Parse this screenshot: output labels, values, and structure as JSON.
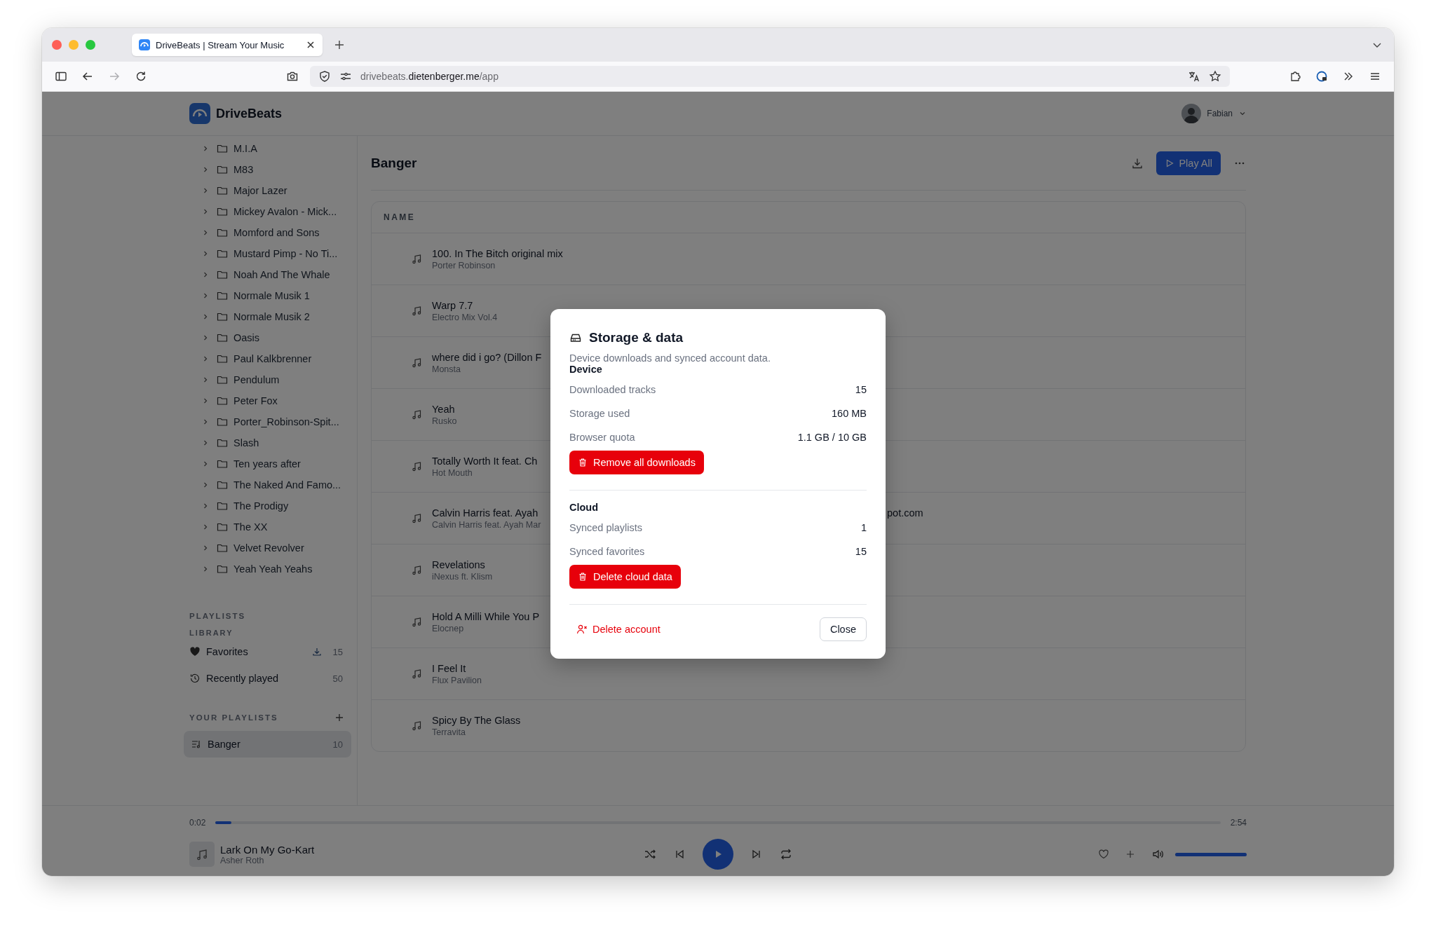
{
  "browser": {
    "tab": {
      "title": "DriveBeats | Stream Your Music"
    },
    "nav": [
      {
        "kind": "back",
        "disabled": false
      },
      {
        "kind": "forward",
        "disabled": true
      },
      {
        "kind": "reload",
        "disabled": false
      }
    ],
    "url": {
      "start": "drivebeats.",
      "domain": "dietenberger.me",
      "path": "/app"
    }
  },
  "app": {
    "name": "DriveBeats",
    "user": {
      "name": "Fabian"
    }
  },
  "sidebar": {
    "folders": [
      {
        "name": "M.I.A",
        "expanded": false
      },
      {
        "name": "M83",
        "expanded": false
      },
      {
        "name": "Major Lazer",
        "expanded": false
      },
      {
        "name": "Mickey Avalon - Mick...",
        "expanded": false
      },
      {
        "name": "Momford and Sons",
        "expanded": false
      },
      {
        "name": "Mustard Pimp - No Ti...",
        "expanded": false
      },
      {
        "name": "Noah And The Whale",
        "expanded": false
      },
      {
        "name": "Normale Musik 1",
        "expanded": false
      },
      {
        "name": "Normale Musik 2",
        "expanded": false
      },
      {
        "name": "Oasis",
        "expanded": false
      },
      {
        "name": "Paul Kalkbrenner",
        "expanded": false
      },
      {
        "name": "Pendulum",
        "expanded": false
      },
      {
        "name": "Peter Fox",
        "expanded": false
      },
      {
        "name": "Porter_Robinson-Spit...",
        "expanded": false
      },
      {
        "name": "Slash",
        "expanded": false
      },
      {
        "name": "Ten years after",
        "expanded": false
      },
      {
        "name": "The Naked And Famo...",
        "expanded": false
      },
      {
        "name": "The Prodigy",
        "expanded": false
      },
      {
        "name": "The XX",
        "expanded": false
      },
      {
        "name": "Velvet Revolver",
        "expanded": false
      },
      {
        "name": "Yeah Yeah Yeahs",
        "expanded": false
      }
    ],
    "playlists_heading": "PLAYLISTS",
    "library_heading": "LIBRARY",
    "library": [
      {
        "kind": "favorites",
        "label": "Favorites",
        "count": "15",
        "downloaded": true
      },
      {
        "kind": "recent",
        "label": "Recently played",
        "count": "50",
        "downloaded": false
      }
    ],
    "your_playlists_heading": "YOUR PLAYLISTS",
    "playlists": [
      {
        "label": "Banger",
        "count": "10",
        "selected": true
      }
    ]
  },
  "main": {
    "title": "Banger",
    "play_all": "Play All",
    "table": {
      "columns": [
        "NAME"
      ],
      "rows": [
        {
          "title": "100. In The Bitch original mix",
          "subtitle": "Porter Robinson"
        },
        {
          "title": "Warp 7.7",
          "subtitle": "Electro Mix Vol.4"
        },
        {
          "title": "where did i go? (Dillon F",
          "subtitle": "Monsta"
        },
        {
          "title": "Yeah",
          "subtitle": "Rusko"
        },
        {
          "title": "Totally Worth It feat. Ch",
          "subtitle": "Hot Mouth"
        },
        {
          "title": "Calvin Harris feat. Ayah",
          "title_end": "pot.com",
          "subtitle": "Calvin Harris feat. Ayah Mar"
        },
        {
          "title": "Revelations",
          "subtitle": "iNexus ft. Klism"
        },
        {
          "title": "Hold A Milli While You P",
          "subtitle": "Elocnep"
        },
        {
          "title": "I Feel It",
          "subtitle": "Flux Pavilion"
        },
        {
          "title": "Spicy By The Glass",
          "subtitle": "Terravita"
        }
      ]
    }
  },
  "dialog": {
    "title": "Storage & data",
    "description": "Device downloads and synced account data.",
    "sections": [
      {
        "heading": "Device",
        "rows": [
          {
            "label": "Downloaded tracks",
            "value": "15"
          },
          {
            "label": "Storage used",
            "value": "160 MB"
          },
          {
            "label": "Browser quota",
            "value": "1.1 GB / 10 GB"
          }
        ],
        "action": "Remove all downloads"
      },
      {
        "heading": "Cloud",
        "rows": [
          {
            "label": "Synced playlists",
            "value": "1"
          },
          {
            "label": "Synced favorites",
            "value": "15"
          }
        ],
        "action": "Delete cloud data"
      }
    ],
    "delete_account": "Delete account",
    "close": "Close"
  },
  "player": {
    "elapsed": "0:02",
    "duration": "2:54",
    "level": 0.016,
    "playing": false,
    "track": {
      "title": "Lark On My Go-Kart",
      "artist": "Asher Roth"
    },
    "volume": {
      "level": 1
    }
  }
}
